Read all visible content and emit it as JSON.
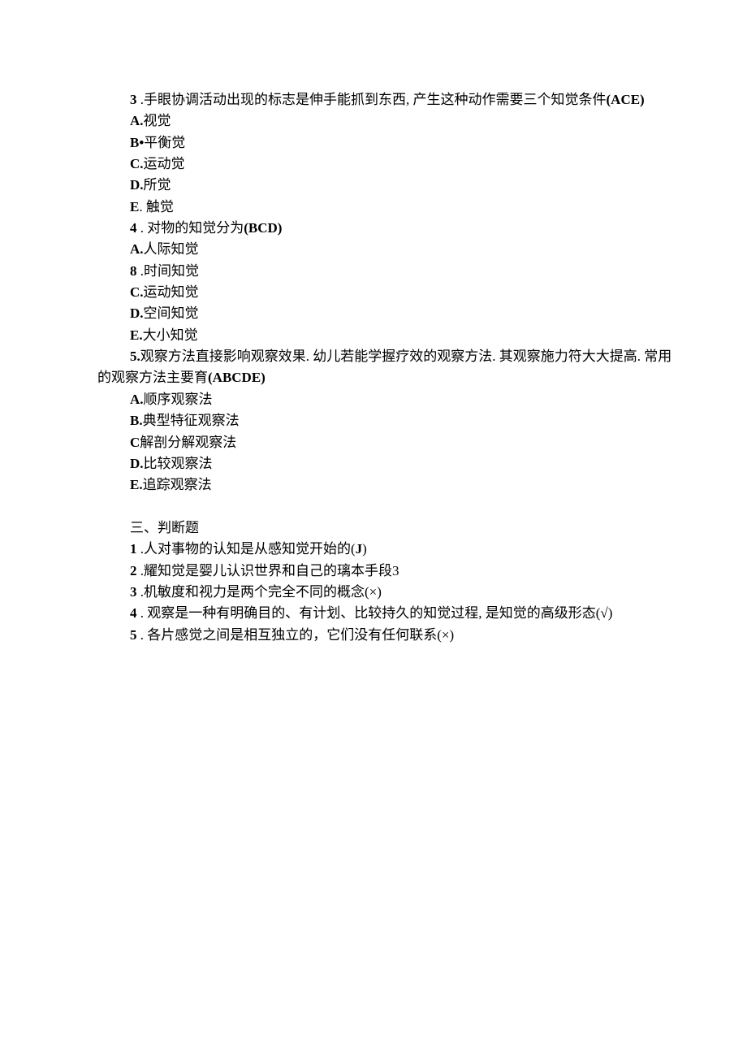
{
  "q3": {
    "num": "3",
    "stem_a": " .手眼协调活动出现的标志是伸手能抓到东西, 产生这种动作需要三个知觉条件",
    "ans": "(ACE)",
    "A_label": "A.",
    "A_text": "视觉",
    "B_label": "B•",
    "B_text": "平衡觉",
    "C_label": "C.",
    "C_text": "运动觉",
    "D_label": "D.",
    "D_text": "所觉",
    "E_label": "E",
    "E_text": ". 触觉"
  },
  "q4": {
    "num": "4",
    "stem_a": " . 对物的知觉分为",
    "ans": "(BCD)",
    "A_label": "A.",
    "A_text": "人际知觉",
    "B_label": "8",
    "B_text": " .时间知觉",
    "C_label": "C.",
    "C_text": "运动知觉",
    "D_label": "D.",
    "D_text": "空间知觉",
    "E_label": "E.",
    "E_text": "大小知觉"
  },
  "q5": {
    "num": "5.",
    "line1": "观察方法直接影响观察效果. 幼儿若能学握疗效的观察方法. 其观察施力符大大提高. 常用",
    "line2": "的观察方法主要育",
    "ans": "(ABCDE)",
    "A_label": "A.",
    "A_text": "顺序观察法",
    "B_label": "B.",
    "B_text": "典型特征观察法",
    "C_label": "C",
    "C_text": "解剖分解观察法",
    "D_label": "D.",
    "D_text": "比较观察法",
    "E_label": "E.",
    "E_text": "追踪观察法"
  },
  "section3": {
    "title": "三、判断题"
  },
  "j1": {
    "num": "1",
    "text": " .人对事物的认知是从感知觉开始的",
    "ans": "(J)"
  },
  "j2": {
    "num": "2",
    "text": " .耀知觉是婴儿认识世界和自己的璃本手段3"
  },
  "j3": {
    "num": "3",
    "text": " .机敏度和视力是两个完全不同的概念(×)"
  },
  "j4": {
    "num": "4",
    "text": " . 观察是一种有明确目的、有计划、比较持久的知觉过程, 是知觉的高级形态(√)"
  },
  "j5": {
    "num": "5",
    "text": " . 各片感觉之间是相互独立的，它们没有任何联系(×)"
  }
}
